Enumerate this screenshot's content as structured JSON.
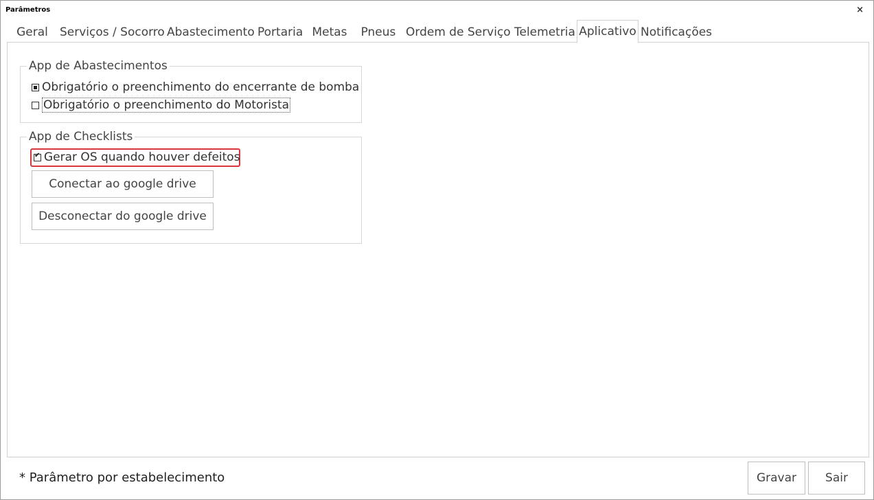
{
  "window": {
    "title": "Parâmetros",
    "close_glyph": "×"
  },
  "tabs": [
    {
      "label": "Geral"
    },
    {
      "label": "Serviços / Socorro"
    },
    {
      "label": "Abastecimento"
    },
    {
      "label": "Portaria"
    },
    {
      "label": "Metas"
    },
    {
      "label": "Pneus"
    },
    {
      "label": "Ordem de Serviço"
    },
    {
      "label": "Telemetria"
    },
    {
      "label": "Aplicativo",
      "active": true
    },
    {
      "label": "Notificações"
    }
  ],
  "app_abastecimentos": {
    "legend": "App de Abastecimentos",
    "options": [
      {
        "label": "Obrigatório o preenchimento do encerrante de bomba",
        "state": "indeterminate"
      },
      {
        "label": "Obrigatório o preenchimento do Motorista",
        "state": "unchecked"
      }
    ]
  },
  "app_checklists": {
    "legend": "App de Checklists",
    "gerar_os": {
      "label": "Gerar OS quando houver defeitos",
      "state": "checked"
    },
    "connect_button": "Conectar ao google drive",
    "disconnect_button": "Desconectar do google drive"
  },
  "footer": {
    "note": "* Parâmetro por estabelecimento",
    "save_button": "Gravar",
    "exit_button": "Sair"
  },
  "colors": {
    "highlight": "#d9363e",
    "border": "#d2d2d2"
  }
}
